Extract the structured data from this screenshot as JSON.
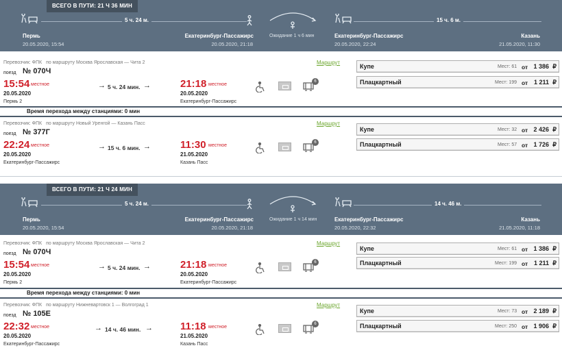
{
  "routes": [
    {
      "total": "ВСЕГО В ПУТИ: 21 Ч 36 МИН",
      "leg1_duration": "5 ч. 24 м.",
      "leg2_duration": "15 ч. 6 м.",
      "wait": "Ожидание 1 ч 6 мин",
      "from_station": "Пермь",
      "from_date": "20.05.2020, 15:54",
      "transfer_station_arr": "Екатеринбург-Пассажирс",
      "transfer_arr_date": "20.05.2020, 21:18",
      "transfer_station_dep": "Екатеринбург-Пассажирс",
      "transfer_dep_date": "20.05.2020, 22:24",
      "to_station": "Казань",
      "to_date": "21.05.2020, 11:30",
      "transfer_note": "Время перехода между станциями: 0 мин",
      "trains": [
        {
          "carrier": "Перевозчик: ФПК",
          "route": "по маршруту Москва Ярославская — Чита 2",
          "route_link": "Маршрут",
          "train_word": "поезд",
          "number": "№ 070Ч",
          "dep_time": "15:54",
          "dep_local": "местное",
          "dep_date": "20.05.2020",
          "dep_station": "Пермь 2",
          "duration": "5 ч. 24 мин.",
          "arr_time": "21:18",
          "arr_local": "местное",
          "arr_date": "20.05.2020",
          "arr_station": "Екатеринбург-Пассажирс",
          "badge": "6",
          "fares": [
            {
              "class": "Купе",
              "seats": "Мест: 61",
              "from": "от",
              "price": "1 386",
              "currency": "₽"
            },
            {
              "class": "Плацкартный",
              "seats": "Мест: 199",
              "from": "от",
              "price": "1 211",
              "currency": "₽"
            }
          ]
        },
        {
          "carrier": "Перевозчик: ФПК",
          "route": "по маршруту Новый Уренгой — Казань Пасс",
          "route_link": "Маршрут",
          "train_word": "поезд",
          "number": "№ 377Г",
          "dep_time": "22:24",
          "dep_local": "местное",
          "dep_date": "20.05.2020",
          "dep_station": "Екатеринбург-Пассажирс",
          "duration": "15 ч. 6 мин.",
          "arr_time": "11:30",
          "arr_local": "местное",
          "arr_date": "21.05.2020",
          "arr_station": "Казань Пасс",
          "badge": "6",
          "fares": [
            {
              "class": "Купе",
              "seats": "Мест: 32",
              "from": "от",
              "price": "2 426",
              "currency": "₽"
            },
            {
              "class": "Плацкартный",
              "seats": "Мест: 57",
              "from": "от",
              "price": "1 726",
              "currency": "₽"
            }
          ]
        }
      ]
    },
    {
      "total": "ВСЕГО В ПУТИ: 21 Ч 24 МИН",
      "leg1_duration": "5 ч. 24 м.",
      "leg2_duration": "14 ч. 46 м.",
      "wait": "Ожидание 1 ч 14 мин",
      "from_station": "Пермь",
      "from_date": "20.05.2020, 15:54",
      "transfer_station_arr": "Екатеринбург-Пассажирс",
      "transfer_arr_date": "20.05.2020, 21:18",
      "transfer_station_dep": "Екатеринбург-Пассажирс",
      "transfer_dep_date": "20.05.2020, 22:32",
      "to_station": "Казань",
      "to_date": "21.05.2020, 11:18",
      "transfer_note": "Время перехода между станциями: 0 мин",
      "trains": [
        {
          "carrier": "Перевозчик: ФПК",
          "route": "по маршруту Москва Ярославская — Чита 2",
          "route_link": "Маршрут",
          "train_word": "поезд",
          "number": "№ 070Ч",
          "dep_time": "15:54",
          "dep_local": "местное",
          "dep_date": "20.05.2020",
          "dep_station": "Пермь 2",
          "duration": "5 ч. 24 мин.",
          "arr_time": "21:18",
          "arr_local": "местное",
          "arr_date": "20.05.2020",
          "arr_station": "Екатеринбург-Пассажирс",
          "badge": "6",
          "fares": [
            {
              "class": "Купе",
              "seats": "Мест: 61",
              "from": "от",
              "price": "1 386",
              "currency": "₽"
            },
            {
              "class": "Плацкартный",
              "seats": "Мест: 199",
              "from": "от",
              "price": "1 211",
              "currency": "₽"
            }
          ]
        },
        {
          "carrier": "Перевозчик: ФПК",
          "route": "по маршруту Нижневартовск 1 — Волгоград 1",
          "route_link": "Маршрут",
          "train_word": "поезд",
          "number": "№ 105Е",
          "dep_time": "22:32",
          "dep_local": "местное",
          "dep_date": "20.05.2020",
          "dep_station": "Екатеринбург-Пассажирс",
          "duration": "14 ч. 46 мин.",
          "arr_time": "11:18",
          "arr_local": "местное",
          "arr_date": "21.05.2020",
          "arr_station": "Казань Пасс",
          "badge": "6",
          "fares": [
            {
              "class": "Купе",
              "seats": "Мест: 73",
              "from": "от",
              "price": "2 189",
              "currency": "₽"
            },
            {
              "class": "Плацкартный",
              "seats": "Мест: 250",
              "from": "от",
              "price": "1 906",
              "currency": "₽"
            }
          ]
        }
      ]
    }
  ]
}
